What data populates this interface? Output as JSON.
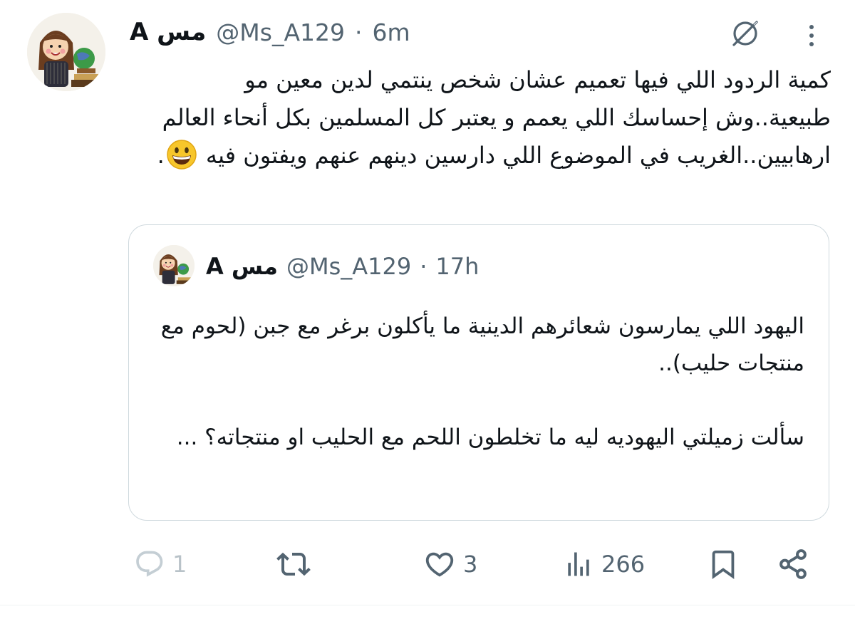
{
  "tweet": {
    "author_name": "مس A",
    "handle": "@Ms_A129",
    "separator": "·",
    "time": "6m",
    "text": "كمية الردود اللي فيها تعميم عشان شخص ينتمي لدين معين مو طبيعية..وش إحساسك اللي يعمم و يعتبر كل المسلمين بكل أنحاء العالم ارهابيين..الغريب في الموضوع اللي دارسين دينهم عنهم ويفتون فيه",
    "text_end_emoji": "grinning-face-emoji"
  },
  "quoted_tweet": {
    "author_name": "مس A",
    "handle": "@Ms_A129",
    "separator": "·",
    "time": "17h",
    "paragraph_1": "اليهود اللي يمارسون شعائرهم الدينية  ما يأكلون برغر مع جبن (لحوم مع منتجات حليب)..",
    "paragraph_2": "سألت زميلتي اليهوديه ليه ما تخلطون اللحم مع الحليب او منتجاته؟ ..."
  },
  "actions": {
    "reply_count": "1",
    "retweet_count": "",
    "like_count": "3",
    "views_count": "266"
  },
  "icons": {
    "grok": "grok-icon",
    "more": "more-vertical-icon",
    "reply": "reply-icon",
    "retweet": "retweet-icon",
    "like": "heart-icon",
    "views": "views-icon",
    "bookmark": "bookmark-icon",
    "share": "share-icon"
  },
  "colors": {
    "text": "#0f1419",
    "muted": "#536471",
    "border": "#cfd9de"
  }
}
